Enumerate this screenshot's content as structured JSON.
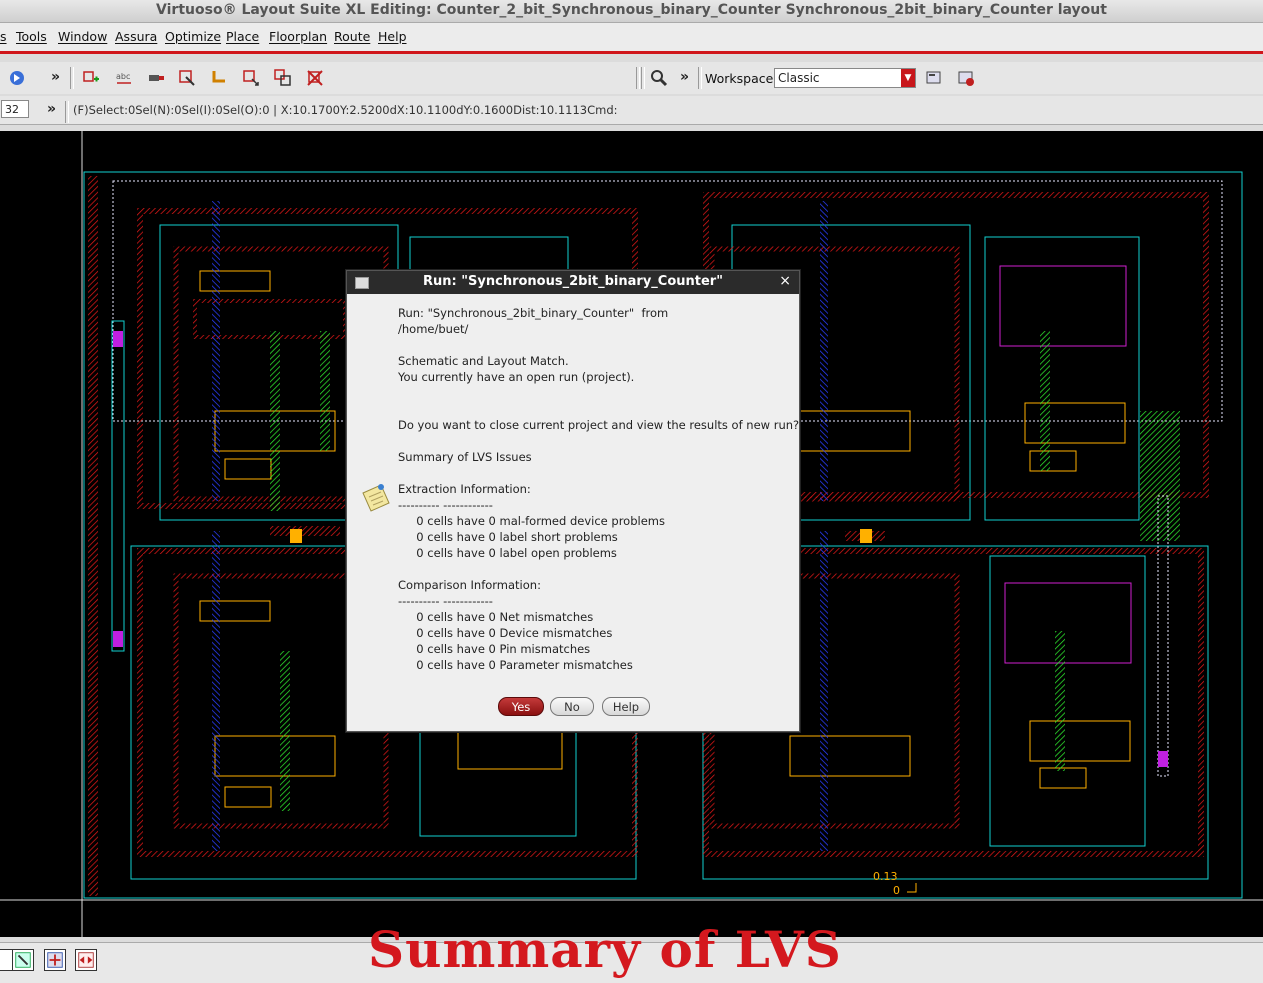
{
  "window": {
    "title": "Virtuoso® Layout Suite XL Editing: Counter_2_bit_Synchronous_binary_Counter Synchronous_2bit_binary_Counter layout"
  },
  "menubar": {
    "items": [
      "s",
      "Tools",
      "Window",
      "Assura",
      "Optimize",
      "Place",
      "Floorplan",
      "Route",
      "Help"
    ]
  },
  "toolbar": {
    "workspace_label": "Workspace:",
    "workspace_value": "Classic",
    "more_glyph": "»",
    "icons": [
      "select-icon",
      "create-instance-icon",
      "label-icon",
      "create-pin-icon",
      "stretch-icon",
      "path-icon",
      "move-icon",
      "copy-icon",
      "delete-icon",
      "zoom-icon",
      "workspace-save-icon",
      "workspace-delete-icon"
    ]
  },
  "statusbar": {
    "zoom_value": "32",
    "more_glyph": "»",
    "text": "(F)Select:0Sel(N):0Sel(I):0Sel(O):0 | X:10.1700Y:2.5200dX:10.1100dY:0.1600Dist:10.1113Cmd:"
  },
  "layout_labels": {
    "dim_label": "0.13",
    "origin_label": "0"
  },
  "dialog": {
    "title": "Run: \"Synchronous_2bit_binary_Counter\"",
    "close_glyph": "×",
    "lines": [
      "Run: \"Synchronous_2bit_binary_Counter\"  from",
      "/home/buet/",
      "",
      "Schematic and Layout Match.",
      "You currently have an open run (project).",
      "",
      "",
      "Do you want to close current project and view the results of new run?",
      "",
      "Summary of LVS Issues",
      "",
      "Extraction Information:",
      "---------- ------------",
      "     0 cells have 0 mal-formed device problems",
      "     0 cells have 0 label short problems",
      "     0 cells have 0 label open problems",
      "",
      "Comparison Information:",
      "---------- ------------",
      "     0 cells have 0 Net mismatches",
      "     0 cells have 0 Device mismatches",
      "     0 cells have 0 Pin mismatches",
      "     0 cells have 0 Parameter mismatches"
    ],
    "buttons": {
      "yes": "Yes",
      "no": "No",
      "help": "Help"
    }
  },
  "caption": "Summary of LVS",
  "colors": {
    "accent": "#d0161b",
    "canvas": "#000000",
    "metal1": "#1a2dff",
    "poly": "#e01818",
    "active": "#2ee82e",
    "nwell": "#12d0d0",
    "implant": "#ffb000",
    "contact": "#c8c8ff"
  }
}
